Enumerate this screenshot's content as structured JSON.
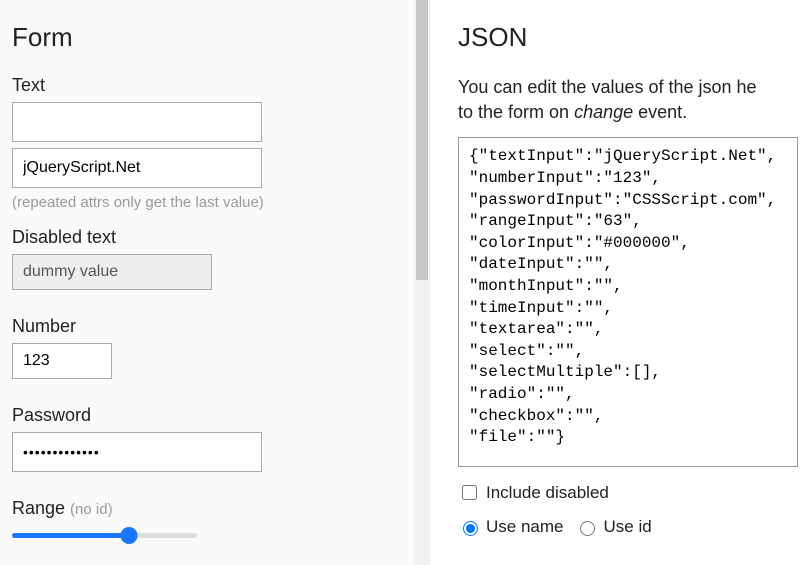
{
  "form": {
    "heading": "Form",
    "text_label": "Text",
    "text_value1": "",
    "text_value2": "jQueryScript.Net",
    "text_hint": "(repeated attrs only get the last value)",
    "disabled_label": "Disabled text",
    "disabled_value": "dummy value",
    "number_label": "Number",
    "number_value": "123",
    "password_label": "Password",
    "password_display": "•••••••••••••",
    "range_label": "Range ",
    "range_hint": "(no id)",
    "range_value": 63
  },
  "json_panel": {
    "heading": "JSON",
    "intro_1": "You can edit the values of the json he",
    "intro_2": "to the form on ",
    "intro_em": "change",
    "intro_3": " event.",
    "json_text": "{\"textInput\":\"jQueryScript.Net\",\n\"numberInput\":\"123\",\n\"passwordInput\":\"CSSScript.com\",\n\"rangeInput\":\"63\",\n\"colorInput\":\"#000000\",\n\"dateInput\":\"\",\n\"monthInput\":\"\",\n\"timeInput\":\"\",\n\"textarea\":\"\",\n\"select\":\"\",\n\"selectMultiple\":[],\n\"radio\":\"\",\n\"checkbox\":\"\",\n\"file\":\"\"}",
    "include_disabled_label": "Include disabled",
    "include_disabled_checked": false,
    "use_name_label": "Use name",
    "use_id_label": "Use id",
    "mode_selected": "name"
  }
}
